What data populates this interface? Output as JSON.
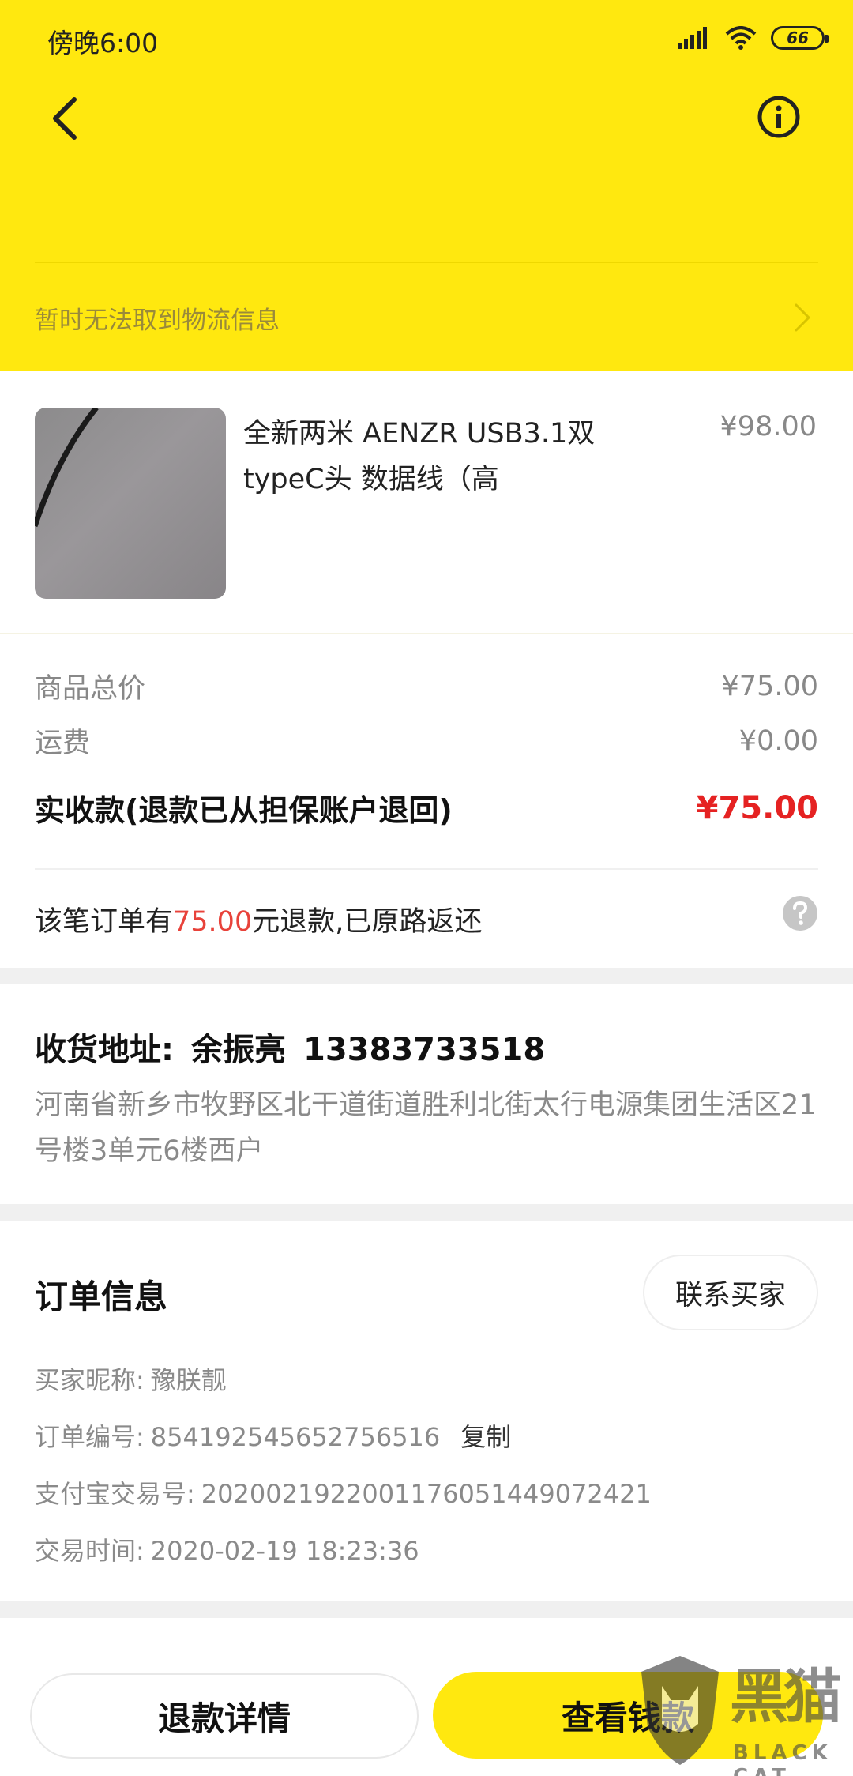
{
  "status_bar": {
    "time": "傍晚6:00",
    "battery": "66"
  },
  "header": {
    "logistics_text": "暂时无法取到物流信息"
  },
  "product": {
    "title": "全新两米 AENZR USB3.1双typeC头 数据线（高",
    "price": "¥98.00"
  },
  "totals": {
    "subtotal_label": "商品总价",
    "subtotal_value": "¥75.00",
    "shipping_label": "运费",
    "shipping_value": "¥0.00",
    "received_label": "实收款(退款已从担保账户退回)",
    "received_value": "¥75.00",
    "refund_note_prefix": "该笔订单有",
    "refund_note_amount": "75.00",
    "refund_note_suffix": "元退款,已原路返还"
  },
  "address": {
    "label": "收货地址:",
    "name": "余振亮",
    "phone": "13383733518",
    "detail": "河南省新乡市牧野区北干道街道胜利北街太行电源集团生活区21号楼3单元6楼西户"
  },
  "order_info": {
    "heading": "订单信息",
    "contact_button": "联系买家",
    "buyer_nick_label": "买家昵称:",
    "buyer_nick_value": "豫朕靓",
    "order_no_label": "订单编号:",
    "order_no_value": "854192545652756516",
    "copy_label": "复制",
    "alipay_no_label": "支付宝交易号:",
    "alipay_no_value": "2020021922001176051449072421",
    "trade_time_label": "交易时间:",
    "trade_time_value": "2020-02-19 18:23:36"
  },
  "actions": {
    "refund_detail": "退款详情",
    "view_wallet": "查看钱款"
  },
  "watermark": {
    "text": "黑猫",
    "sub": "BLACK CAT"
  },
  "colors": {
    "brand_yellow": "#ffe80f",
    "price_red": "#e52222",
    "refund_red": "#e8423a"
  },
  "icons": [
    "back-arrow-icon",
    "info-icon",
    "chevron-right-icon",
    "help-icon",
    "signal-icon",
    "wifi-icon",
    "battery-icon"
  ]
}
